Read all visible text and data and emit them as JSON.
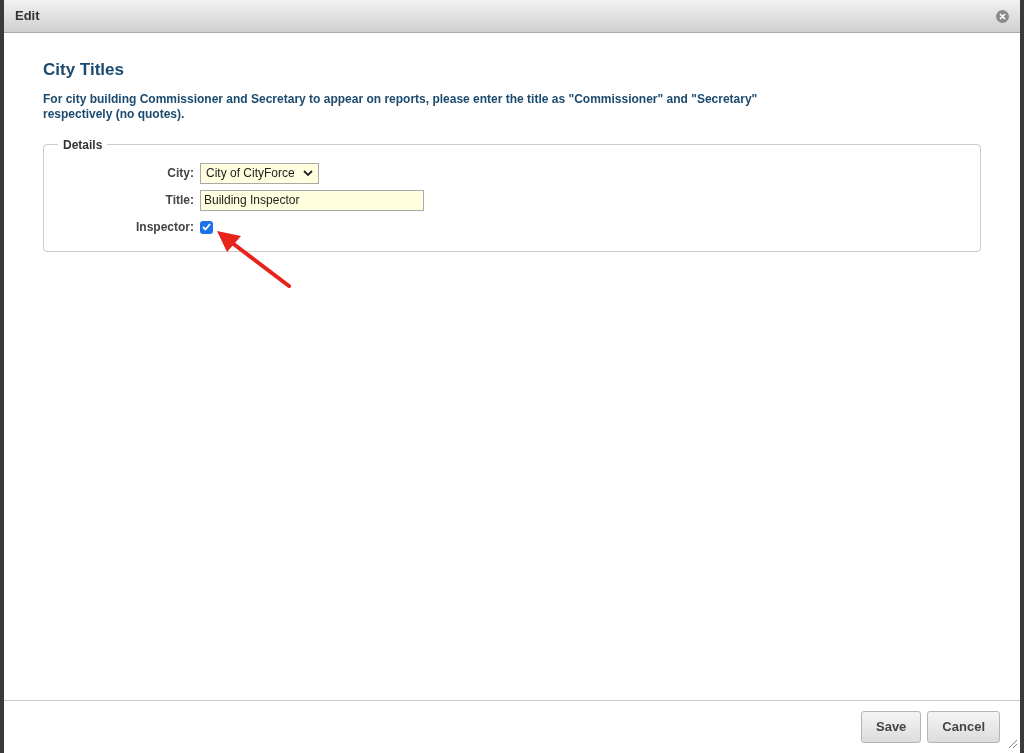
{
  "window": {
    "title": "Edit"
  },
  "heading": "City Titles",
  "note": "For city building Commissioner and Secretary to appear on reports, please enter the title as \"Commissioner\" and \"Secretary\" respectively (no quotes).",
  "details": {
    "legend": "Details",
    "fields": [
      {
        "kind": "select",
        "label": "City:",
        "value": "City of CityForce"
      },
      {
        "kind": "text",
        "label": "Title:",
        "value": "Building Inspector"
      },
      {
        "kind": "checkbox",
        "label": "Inspector:",
        "checked": true
      }
    ]
  },
  "buttons": [
    "Save",
    "Cancel"
  ]
}
